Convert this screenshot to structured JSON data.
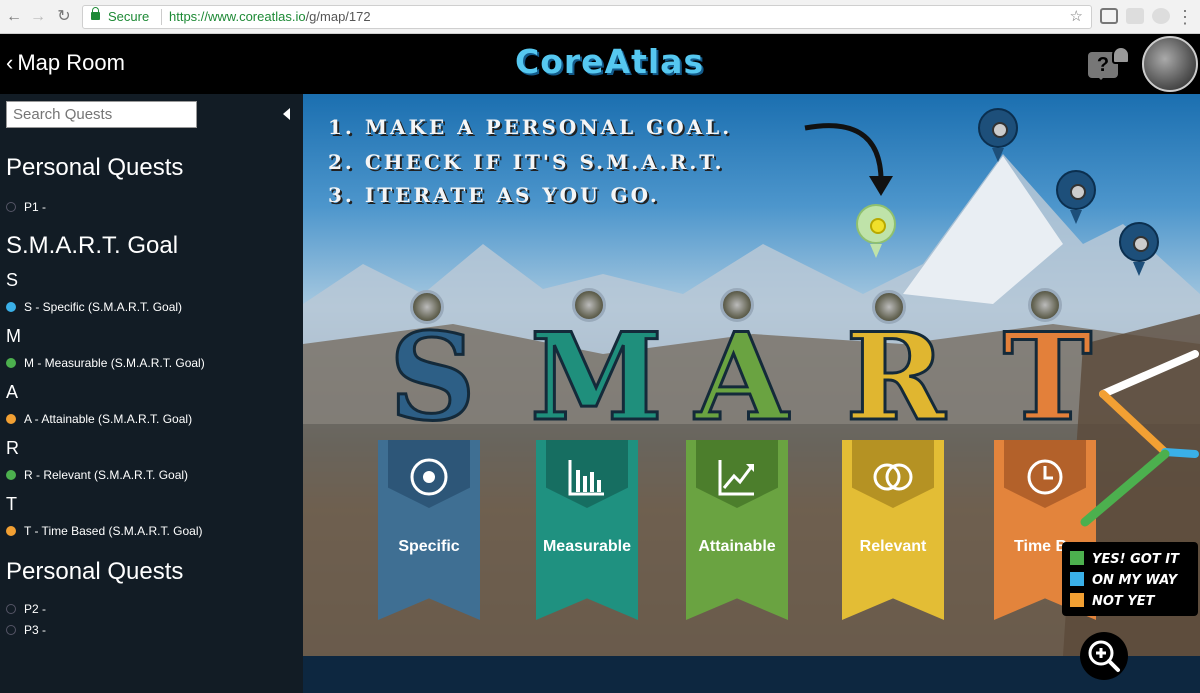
{
  "browser": {
    "secure_label": "Secure",
    "url_host": "https://www.coreatlas.io",
    "url_path": "/g/map/172"
  },
  "header": {
    "back_label": "Map Room",
    "logo": "CoreAtlas",
    "help_symbol": "?"
  },
  "sidebar": {
    "search_placeholder": "Search Quests",
    "sections": [
      {
        "title": "Personal Quests",
        "items": [
          {
            "label": "P1 -",
            "status": "empty"
          }
        ]
      },
      {
        "title": "S.M.A.R.T. Goal"
      }
    ],
    "groups": [
      {
        "letter": "S",
        "label": "S - Specific (S.M.A.R.T. Goal)",
        "status": "on my way",
        "color": "#3ab0e8"
      },
      {
        "letter": "M",
        "label": "M - Measurable (S.M.A.R.T. Goal)",
        "status": "yes got it",
        "color": "#4cb04e"
      },
      {
        "letter": "A",
        "label": "A - Attainable (S.M.A.R.T. Goal)",
        "status": "not yet",
        "color": "#f2a033"
      },
      {
        "letter": "R",
        "label": "R - Relevant (S.M.A.R.T. Goal)",
        "status": "yes got it",
        "color": "#4cb04e"
      },
      {
        "letter": "T",
        "label": "T - Time Based (S.M.A.R.T. Goal)",
        "status": "not yet",
        "color": "#f2a033"
      }
    ],
    "personal2": {
      "title": "Personal Quests",
      "items": [
        {
          "label": "P2 -"
        },
        {
          "label": "P3 -"
        }
      ]
    }
  },
  "map": {
    "instructions": [
      "1. MAKE A PERSONAL GOAL.",
      "2. CHECK IF IT'S S.M.A.R.T.",
      "3. ITERATE AS YOU GO."
    ],
    "letters": [
      {
        "char": "S",
        "color": "#2d5f86"
      },
      {
        "char": "M",
        "color": "#1f8f7c"
      },
      {
        "char": "A",
        "color": "#6aa341"
      },
      {
        "char": "R",
        "color": "#e0b630"
      },
      {
        "char": "T",
        "color": "#e3803a"
      }
    ],
    "banners": [
      {
        "label": "Specific",
        "color": "#3f6f93",
        "flap": "#2d5678",
        "icon": "target-icon"
      },
      {
        "label": "Measurable",
        "color": "#1f9180",
        "flap": "#166e61",
        "icon": "bar-chart-icon"
      },
      {
        "label": "Attainable",
        "color": "#6aa341",
        "flap": "#4c7e2c",
        "icon": "trend-line-icon"
      },
      {
        "label": "Relevant",
        "color": "#e3bd35",
        "flap": "#b59223",
        "icon": "rings-icon"
      },
      {
        "label": "Time Ba",
        "color": "#e3843c",
        "flap": "#b3612a",
        "icon": "clock-icon"
      }
    ],
    "legend": [
      {
        "label": "YES! GOT IT",
        "color": "#4cb04e"
      },
      {
        "label": "ON MY WAY",
        "color": "#3ab0e8"
      },
      {
        "label": "NOT YET",
        "color": "#f2a033"
      }
    ]
  }
}
